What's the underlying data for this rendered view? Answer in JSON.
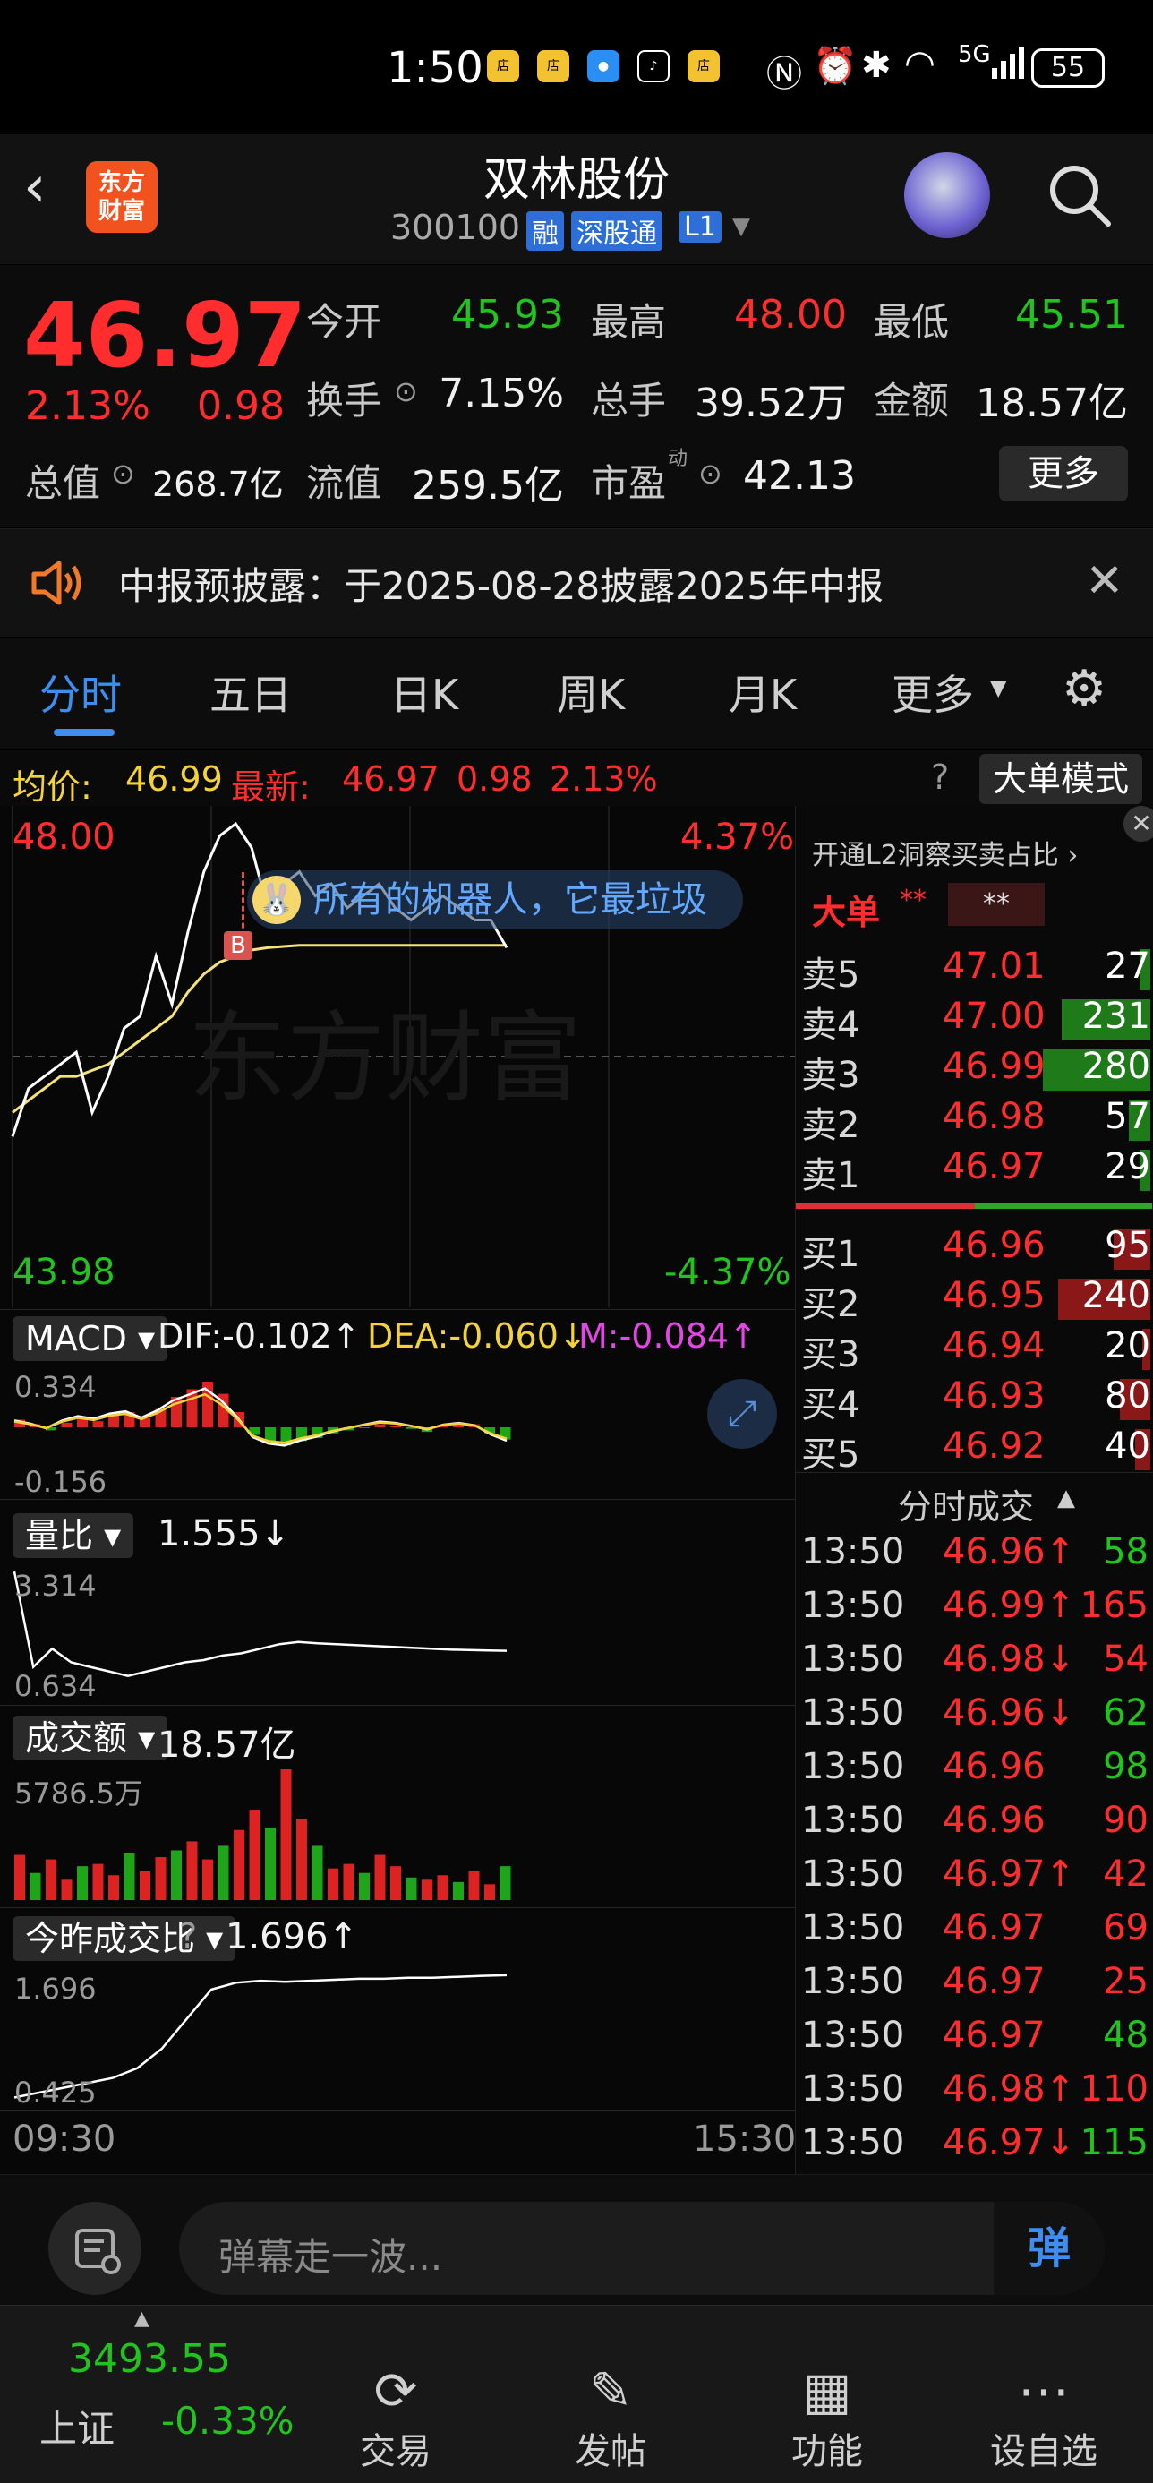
{
  "status_bar": {
    "time": "1:50",
    "battery": "55",
    "network": "5G"
  },
  "header": {
    "logo_text": "东方\n财富",
    "stock_name": "双林股份",
    "stock_code": "300100",
    "badges": [
      "融",
      "深股通",
      "L1"
    ]
  },
  "quote": {
    "price": "46.97",
    "change_pct": "2.13%",
    "change": "0.98",
    "open_label": "今开",
    "open": "45.93",
    "high_label": "最高",
    "high": "48.00",
    "low_label": "最低",
    "low": "45.51",
    "turnover_label": "换手",
    "turnover": "7.15%",
    "volume_label": "总手",
    "volume": "39.52万",
    "amount_label": "金额",
    "amount": "18.57亿",
    "mktcap_label": "总值",
    "mktcap": "268.7亿",
    "float_label": "流值",
    "float_cap": "259.5亿",
    "pe_label": "市盈",
    "pe_sup": "动",
    "pe": "42.13",
    "more_button": "更多"
  },
  "notice": {
    "text": "中报预披露：于2025-08-28披露2025年中报"
  },
  "tabs": [
    "分时",
    "五日",
    "日K",
    "周K",
    "月K",
    "更多"
  ],
  "chart_header": {
    "avg_label": "均价:",
    "avg": "46.99",
    "latest_label": "最新:",
    "latest": "46.97",
    "latest_change": "0.98",
    "latest_pct": "2.13%",
    "big_order_button": "大单模式"
  },
  "chart_data": [
    {
      "type": "line",
      "title": "",
      "y_labels": {
        "top": "48.00",
        "bottom": "43.98",
        "top_pct": "4.37%",
        "bottom_pct": "-4.37%"
      },
      "ylim": [
        43.98,
        48.0
      ],
      "prev_close": 45.99,
      "watermark": "东方财富",
      "series": [
        {
          "name": "price",
          "color": "#ffffff",
          "values": [
            45.4,
            45.8,
            45.9,
            46.0,
            46.1,
            45.6,
            45.9,
            46.3,
            46.4,
            46.9,
            46.5,
            47.1,
            47.6,
            47.9,
            48.0,
            47.8,
            47.3,
            47.5,
            47.6,
            47.4,
            47.5,
            47.3,
            47.4,
            47.5,
            47.3,
            47.2,
            47.3,
            47.4,
            47.3,
            47.2,
            47.2,
            46.97
          ]
        },
        {
          "name": "average",
          "color": "#f4e27a",
          "values": [
            45.6,
            45.7,
            45.8,
            45.9,
            45.9,
            45.95,
            46.0,
            46.1,
            46.2,
            46.3,
            46.4,
            46.6,
            46.75,
            46.85,
            46.9,
            46.95,
            46.97,
            46.98,
            46.99,
            46.99,
            46.99,
            46.99,
            46.99,
            46.99,
            46.99,
            46.99,
            46.99,
            46.99,
            46.99,
            46.99,
            46.99,
            46.99
          ]
        }
      ],
      "annotations": [
        "所有的机器人，它最垃圾"
      ],
      "x_labels": [
        "09:30",
        "15:30"
      ]
    },
    {
      "type": "bar",
      "title": "MACD",
      "dif_label": "DIF:-0.102↑",
      "dea_label": "DEA:-0.060↓",
      "m_label": "M:-0.084↑",
      "y_labels": [
        "0.334",
        "-0.156"
      ],
      "values": [
        0.05,
        0.02,
        -0.02,
        0.03,
        0.06,
        0.04,
        0.08,
        0.1,
        0.06,
        0.12,
        0.2,
        0.25,
        0.3,
        0.22,
        0.1,
        -0.05,
        -0.1,
        -0.12,
        -0.09,
        -0.07,
        -0.04,
        -0.02,
        0.0,
        0.02,
        0.01,
        -0.01,
        -0.03,
        0.01,
        0.03,
        0.02,
        -0.04,
        -0.08
      ]
    },
    {
      "type": "line",
      "title": "量比",
      "value_label": "1.555↓",
      "y_labels": [
        "3.314",
        "0.634"
      ],
      "values": [
        3.3,
        1.2,
        1.6,
        1.3,
        1.2,
        1.1,
        1.0,
        1.1,
        1.2,
        1.3,
        1.35,
        1.45,
        1.5,
        1.6,
        1.7,
        1.75,
        1.72,
        1.7,
        1.68,
        1.66,
        1.64,
        1.62,
        1.6,
        1.58,
        1.57,
        1.56,
        1.555
      ]
    },
    {
      "type": "bar",
      "title": "成交额",
      "value_label": "18.57亿",
      "y_labels": [
        "5786.5万"
      ],
      "values": [
        2000,
        1200,
        1800,
        900,
        1500,
        1600,
        1100,
        2100,
        1300,
        1900,
        2200,
        2600,
        1800,
        2400,
        3100,
        4000,
        3200,
        5786,
        3600,
        2400,
        1400,
        1600,
        1200,
        2000,
        1500,
        1000,
        900,
        1100,
        800,
        1300,
        700,
        1500
      ]
    },
    {
      "type": "line",
      "title": "今昨成交比",
      "value_label": "1.696↑",
      "y_labels": [
        "1.696",
        "0.425"
      ],
      "values": [
        0.45,
        0.5,
        0.55,
        0.6,
        0.65,
        0.75,
        0.95,
        1.25,
        1.55,
        1.62,
        1.64,
        1.63,
        1.64,
        1.65,
        1.66,
        1.66,
        1.67,
        1.67,
        1.68,
        1.69,
        1.696
      ]
    }
  ],
  "order_book": {
    "header": "开通L2洞察买卖占比 ›",
    "big_order_label": "大单",
    "big_order_v1": "**",
    "big_order_v2": "**",
    "asks": [
      {
        "label": "卖5",
        "price": "47.01",
        "qty": "27"
      },
      {
        "label": "卖4",
        "price": "47.00",
        "qty": "231"
      },
      {
        "label": "卖3",
        "price": "46.99",
        "qty": "280"
      },
      {
        "label": "卖2",
        "price": "46.98",
        "qty": "57"
      },
      {
        "label": "卖1",
        "price": "46.97",
        "qty": "29"
      }
    ],
    "bids": [
      {
        "label": "买1",
        "price": "46.96",
        "qty": "95"
      },
      {
        "label": "买2",
        "price": "46.95",
        "qty": "240"
      },
      {
        "label": "买3",
        "price": "46.94",
        "qty": "20"
      },
      {
        "label": "买4",
        "price": "46.93",
        "qty": "80"
      },
      {
        "label": "买5",
        "price": "46.92",
        "qty": "40"
      }
    ],
    "ticks_header": "分时成交",
    "ticks": [
      {
        "time": "13:50",
        "price": "46.96↑",
        "vol": "58",
        "dir": "green"
      },
      {
        "time": "13:50",
        "price": "46.99↑",
        "vol": "165",
        "dir": "red"
      },
      {
        "time": "13:50",
        "price": "46.98↓",
        "vol": "54",
        "dir": "red"
      },
      {
        "time": "13:50",
        "price": "46.96↓",
        "vol": "62",
        "dir": "green"
      },
      {
        "time": "13:50",
        "price": "46.96",
        "vol": "98",
        "dir": "green"
      },
      {
        "time": "13:50",
        "price": "46.96",
        "vol": "90",
        "dir": "red"
      },
      {
        "time": "13:50",
        "price": "46.97↑",
        "vol": "42",
        "dir": "red"
      },
      {
        "time": "13:50",
        "price": "46.97",
        "vol": "69",
        "dir": "red"
      },
      {
        "time": "13:50",
        "price": "46.97",
        "vol": "25",
        "dir": "red"
      },
      {
        "time": "13:50",
        "price": "46.97",
        "vol": "48",
        "dir": "green"
      },
      {
        "time": "13:50",
        "price": "46.98↑",
        "vol": "110",
        "dir": "red"
      },
      {
        "time": "13:50",
        "price": "46.97↓",
        "vol": "115",
        "dir": "green"
      }
    ]
  },
  "chat": {
    "placeholder": "弹幕走一波...",
    "send_glyph": "弹"
  },
  "nav": {
    "index_value": "3493.55",
    "index_name": "上证",
    "index_change": "-0.33%",
    "items": [
      {
        "label": "交易",
        "icon": "yuan-refresh-icon"
      },
      {
        "label": "发帖",
        "icon": "edit-icon"
      },
      {
        "label": "功能",
        "icon": "grid-icon"
      },
      {
        "label": "设自选",
        "icon": "more-dots-icon"
      }
    ]
  }
}
